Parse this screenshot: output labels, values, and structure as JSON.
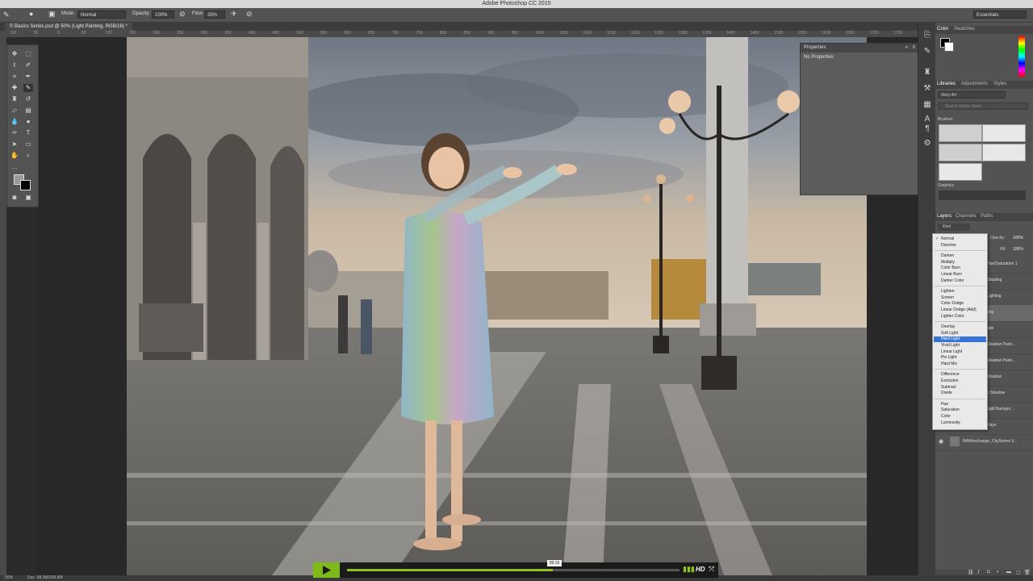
{
  "window": {
    "title": "Adobe Photoshop CC 2015"
  },
  "options_bar": {
    "mode_label": "Mode:",
    "mode_value": "Normal",
    "opacity_label": "Opacity:",
    "opacity_value": "100%",
    "flow_label": "Flow:",
    "flow_value": "26%",
    "workspace_value": "Essentials"
  },
  "document": {
    "tab_label": "© Basics Series.psd @ 50% (Light Painting, RGB/16) *"
  },
  "ruler": {
    "ticks": [
      "100",
      "50",
      "0",
      "50",
      "100",
      "150",
      "200",
      "250",
      "300",
      "350",
      "400",
      "450",
      "500",
      "550",
      "600",
      "650",
      "700",
      "750",
      "800",
      "850",
      "900",
      "950",
      "1000",
      "1050",
      "1100",
      "1150",
      "1200",
      "1250",
      "1300",
      "1350",
      "1400",
      "1450",
      "1500",
      "1550",
      "1600",
      "1650",
      "1700",
      "1750"
    ]
  },
  "properties_panel": {
    "title": "Properties",
    "content": "No Properties"
  },
  "color_panel": {
    "tabs": [
      "Color",
      "Swatches"
    ]
  },
  "libraries_panel": {
    "tabs": [
      "Libraries",
      "Adjustments",
      "Styles"
    ],
    "library_name": "Story Art",
    "search_placeholder": "Search Adobe Stock",
    "brushes_label": "Brushes",
    "graphics_label": "Graphics"
  },
  "layers_panel": {
    "tabs": [
      "Layers",
      "Channels",
      "Paths"
    ],
    "filter_label": "Kind",
    "opacity_label": "Opacity:",
    "opacity_value": "100%",
    "fill_label": "Fill:",
    "fill_value": "100%",
    "layers": [
      {
        "name": "Hue/Saturation 1"
      },
      {
        "name": "Shading"
      },
      {
        "name": "Lighting"
      },
      {
        "name": "ting"
      },
      {
        "name": "ade"
      },
      {
        "name": "Shadow Paint..."
      },
      {
        "name": "Shadow Paint..."
      },
      {
        "name": "Shadow"
      },
      {
        "name": "p Shadow"
      },
      {
        "name": "Spill Backgro..."
      },
      {
        "name": "Rays"
      },
      {
        "name": "RAWexchange_CitySeries-V..."
      }
    ]
  },
  "blend_dropdown": {
    "items": [
      "Normal",
      "Dissolve",
      "Darken",
      "Multiply",
      "Color Burn",
      "Linear Burn",
      "Darker Color",
      "Lighten",
      "Screen",
      "Color Dodge",
      "Linear Dodge (Add)",
      "Lighter Color",
      "Overlay",
      "Soft Light",
      "Hard Light",
      "Vivid Light",
      "Linear Light",
      "Pin Light",
      "Hard Mix",
      "Difference",
      "Exclusion",
      "Subtract",
      "Divide",
      "Hue",
      "Saturation",
      "Color",
      "Luminosity"
    ],
    "checked": "Normal",
    "highlighted": "Hard Light"
  },
  "status_bar": {
    "zoom": "50%",
    "doc_info": "Doc: 98.3M/334.8M"
  },
  "video_player": {
    "time": "05:15",
    "progress": 0.62,
    "hd_label": "HD",
    "accent": "#8fc31f"
  }
}
